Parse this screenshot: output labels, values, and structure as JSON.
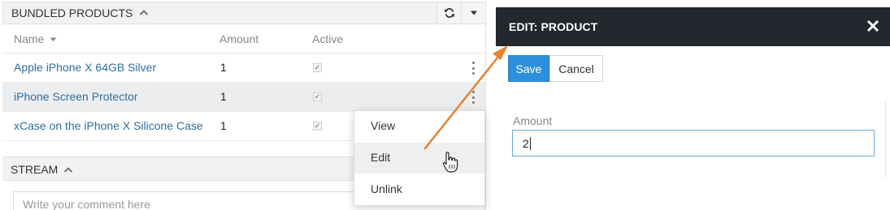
{
  "bundled_panel": {
    "title": "BUNDLED PRODUCTS",
    "columns": {
      "name": "Name",
      "amount": "Amount",
      "active": "Active"
    },
    "rows": [
      {
        "name": "Apple iPhone X 64GB Silver",
        "amount": "1"
      },
      {
        "name": "iPhone Screen Protector",
        "amount": "1"
      },
      {
        "name": "xCase on the iPhone X Silicone Case",
        "amount": "1"
      }
    ]
  },
  "context_menu": {
    "items": [
      "View",
      "Edit",
      "Unlink"
    ]
  },
  "stream_panel": {
    "title": "STREAM",
    "comment_placeholder": "Write your comment here"
  },
  "edit_dialog": {
    "title": "EDIT: PRODUCT",
    "save_label": "Save",
    "cancel_label": "Cancel",
    "amount_label": "Amount",
    "amount_value": "2"
  },
  "colors": {
    "link": "#2f6f9f",
    "save_button": "#2f8fdd",
    "modal_header": "#22282e",
    "arrow": "#e8822f"
  },
  "icons": [
    "chevron-up-icon",
    "refresh-icon",
    "caret-down-icon",
    "sort-caret-icon",
    "checkbox-icon",
    "kebab-icon",
    "close-icon",
    "pointer-hand-icon",
    "annotation-arrow"
  ]
}
